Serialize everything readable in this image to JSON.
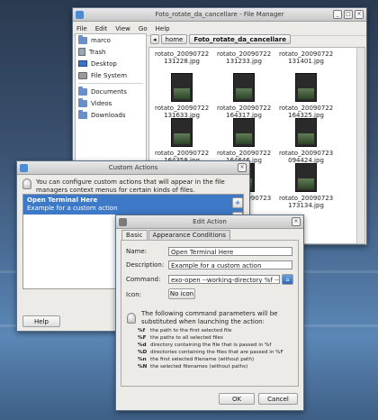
{
  "file_manager": {
    "title": "Foto_rotate_da_cancellare - File Manager",
    "menu": [
      "File",
      "Edit",
      "View",
      "Go",
      "Help"
    ],
    "sidebar": [
      {
        "label": "marco",
        "icon": "folder-home-icon"
      },
      {
        "label": "Trash",
        "icon": "trash-icon"
      },
      {
        "label": "Desktop",
        "icon": "desktop-icon"
      },
      {
        "label": "File System",
        "icon": "drive-icon"
      },
      {
        "label": "Documents",
        "icon": "folder-icon"
      },
      {
        "label": "Videos",
        "icon": "folder-icon"
      },
      {
        "label": "Downloads",
        "icon": "folder-icon"
      }
    ],
    "path": [
      "home",
      "Foto_rotate_da_cancellare"
    ],
    "files": [
      "rotato_20090722 131228.jpg",
      "rotato_20090722 131233.jpg",
      "rotato_20090722 131401.jpg",
      "rotato_20090722 131633.jpg",
      "rotato_20090722 164317.jpg",
      "rotato_20090722 164325.jpg",
      "rotato_20090722 164358.jpg",
      "rotato_20090722 164646.jpg",
      "rotato_20090723 094424.jpg",
      "rotato_20090723",
      "rotato_20090723 173134.jpg"
    ]
  },
  "custom_actions": {
    "title": "Custom Actions",
    "info": "You can configure custom actions that will appear in the file managers context menus for certain kinds of files.",
    "selected_name": "Open Terminal Here",
    "selected_desc": "Example for a custom action",
    "help_label": "Help"
  },
  "edit_action": {
    "title": "Edit Action",
    "tabs": [
      "Basic",
      "Appearance Conditions"
    ],
    "name_label": "Name:",
    "name_value": "Open Terminal Here",
    "description_label": "Description:",
    "description_value": "Example for a custom action",
    "command_label": "Command:",
    "command_value": "exo-open --working-directory %f --laun",
    "icon_label": "Icon:",
    "icon_button": "No icon",
    "params_intro": "The following command parameters will be substituted when launching the action:",
    "params": [
      {
        "code": "%f",
        "desc": "the path to the first selected file"
      },
      {
        "code": "%F",
        "desc": "the paths to all selected files"
      },
      {
        "code": "%d",
        "desc": "directory containing the file that is passed in %f"
      },
      {
        "code": "%D",
        "desc": "directories containing the files that are passed in %F"
      },
      {
        "code": "%n",
        "desc": "the first selected filename (without path)"
      },
      {
        "code": "%N",
        "desc": "the selected filenames (without paths)"
      }
    ],
    "ok_label": "OK",
    "cancel_label": "Cancel"
  }
}
